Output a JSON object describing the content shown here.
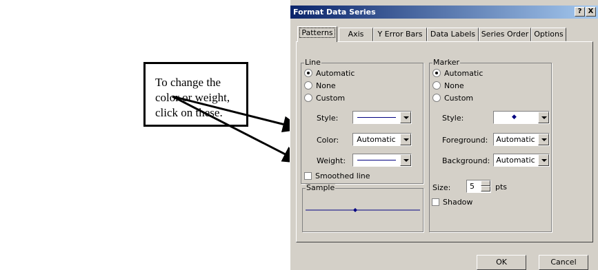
{
  "callout": {
    "text": "To change the color or weight, click on these."
  },
  "dialog": {
    "title": "Format Data Series",
    "help_label": "?",
    "close_label": "X",
    "tabs": [
      {
        "label": "Patterns"
      },
      {
        "label": "Axis"
      },
      {
        "label": "Y Error Bars"
      },
      {
        "label": "Data Labels"
      },
      {
        "label": "Series Order"
      },
      {
        "label": "Options"
      }
    ],
    "active_tab": "Patterns",
    "line": {
      "group_title": "Line",
      "options": [
        "Automatic",
        "None",
        "Custom"
      ],
      "selected": "Automatic",
      "style_label": "Style:",
      "color_label": "Color:",
      "color_value": "Automatic",
      "weight_label": "Weight:",
      "smoothed_label": "Smoothed line",
      "smoothed_checked": false
    },
    "marker": {
      "group_title": "Marker",
      "options": [
        "Automatic",
        "None",
        "Custom"
      ],
      "selected": "Automatic",
      "style_label": "Style:",
      "foreground_label": "Foreground:",
      "foreground_value": "Automatic",
      "background_label": "Background:",
      "background_value": "Automatic",
      "size_label": "Size:",
      "size_value": "5",
      "size_unit": "pts",
      "shadow_label": "Shadow",
      "shadow_checked": false
    },
    "sample": {
      "group_title": "Sample"
    },
    "ok_label": "OK",
    "cancel_label": "Cancel"
  },
  "colors": {
    "title_start": "#0a246a",
    "title_end": "#a6caf0",
    "dialog_bg": "#d4d0c8",
    "line_color": "#000080"
  }
}
